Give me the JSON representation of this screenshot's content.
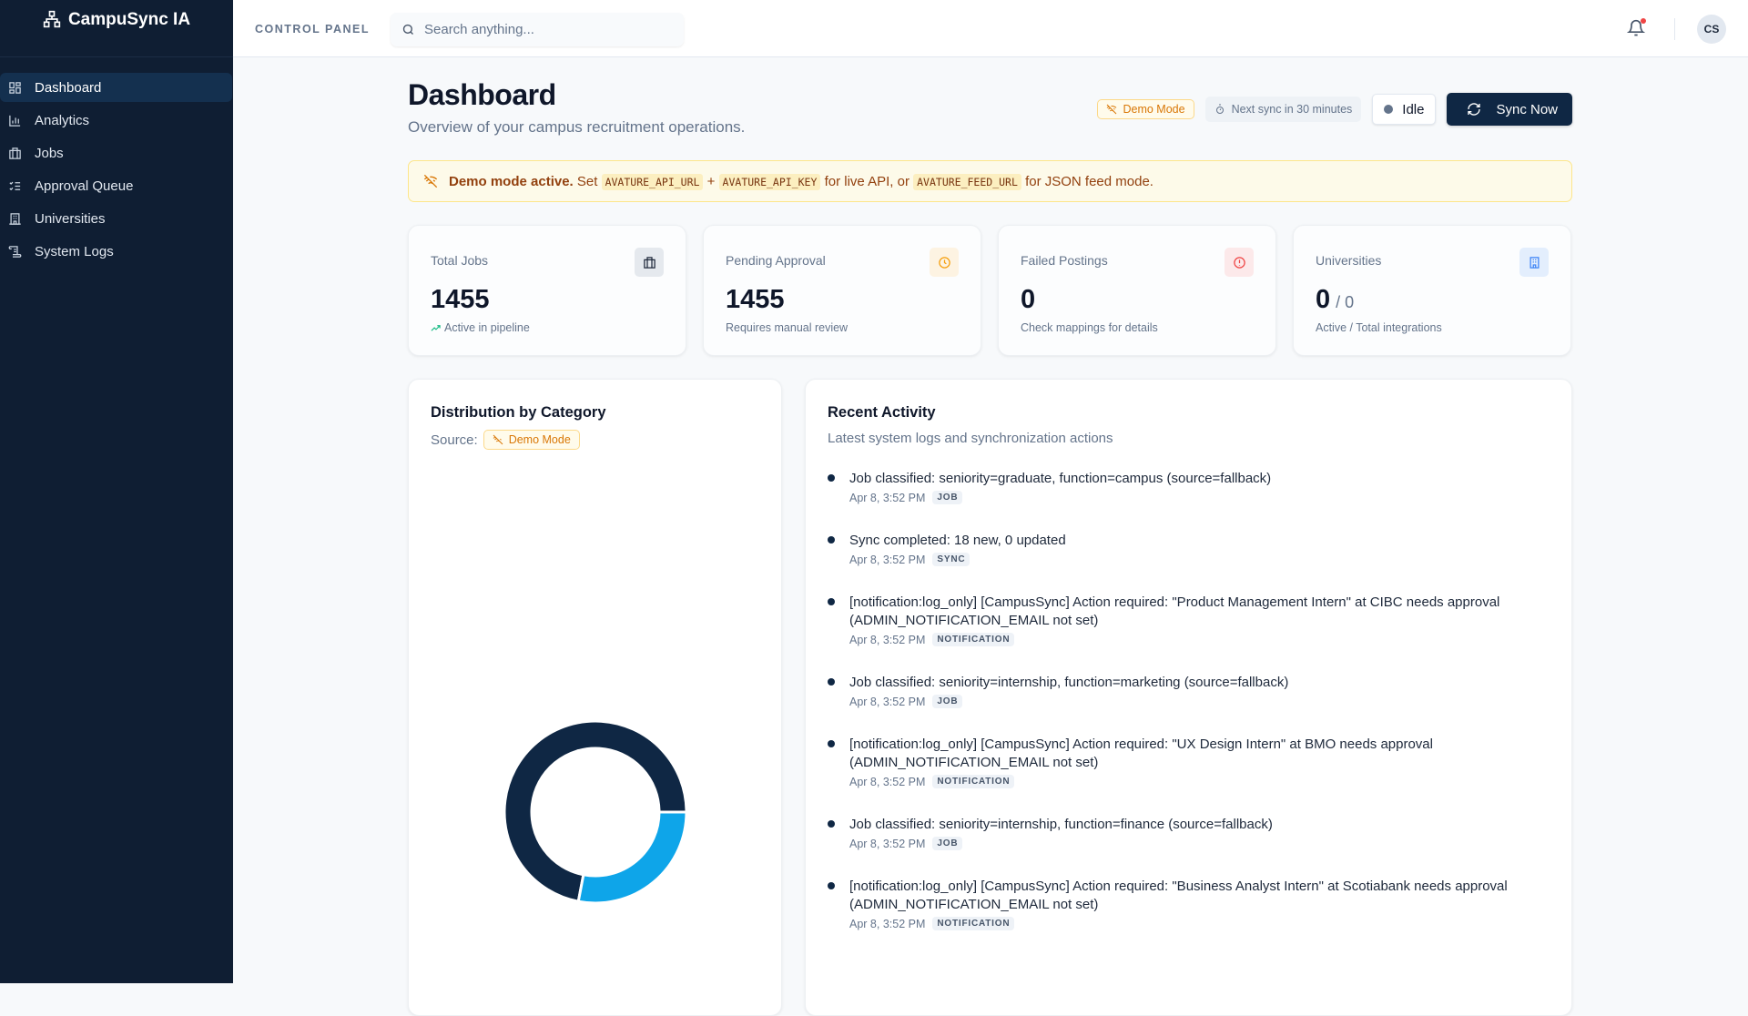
{
  "app": {
    "name": "CampuSync IA"
  },
  "sidebar": {
    "items": [
      {
        "label": "Dashboard",
        "icon": "dashboard-icon"
      },
      {
        "label": "Analytics",
        "icon": "bar-chart-icon"
      },
      {
        "label": "Jobs",
        "icon": "briefcase-icon"
      },
      {
        "label": "Approval Queue",
        "icon": "list-checks-icon"
      },
      {
        "label": "Universities",
        "icon": "building-icon"
      },
      {
        "label": "System Logs",
        "icon": "scroll-icon"
      }
    ]
  },
  "topbar": {
    "section": "CONTROL PANEL",
    "search_placeholder": "Search anything...",
    "avatar": "CS"
  },
  "header": {
    "title": "Dashboard",
    "subtitle": "Overview of your campus recruitment operations.",
    "demo_badge": "Demo Mode",
    "next_sync": "Next sync in 30 minutes",
    "status": "Idle",
    "sync_button": "Sync Now"
  },
  "banner": {
    "bold": "Demo mode active.",
    "t1": "Set",
    "code1": "AVATURE_API_URL",
    "t2": "+",
    "code2": "AVATURE_API_KEY",
    "t3": "for live API, or",
    "code3": "AVATURE_FEED_URL",
    "t4": "for JSON feed mode."
  },
  "stats": [
    {
      "label": "Total Jobs",
      "value": "1455",
      "sub": "Active in pipeline",
      "color": "#334155"
    },
    {
      "label": "Pending Approval",
      "value": "1455",
      "sub": "Requires manual review",
      "color": "#f59e0b"
    },
    {
      "label": "Failed Postings",
      "value": "0",
      "sub": "Check mappings for details",
      "color": "#ef4444"
    },
    {
      "label": "Universities",
      "value": "0",
      "total": "/ 0",
      "sub": "Active / Total integrations",
      "color": "#3b82f6"
    }
  ],
  "distribution": {
    "title": "Distribution by Category",
    "source_label": "Source:",
    "source_badge": "Demo Mode"
  },
  "chart_data": {
    "type": "pie",
    "donut": true,
    "title": "Distribution by Category",
    "series": [
      {
        "value": 72,
        "color": "#0f2744"
      },
      {
        "value": 28,
        "color": "#0ea5e9"
      }
    ]
  },
  "activity": {
    "title": "Recent Activity",
    "subtitle": "Latest system logs and synchronization actions",
    "items": [
      {
        "text": "Job classified: seniority=graduate, function=campus (source=fallback)",
        "time": "Apr 8, 3:52 PM",
        "tag": "JOB"
      },
      {
        "text": "Sync completed: 18 new, 0 updated",
        "time": "Apr 8, 3:52 PM",
        "tag": "SYNC"
      },
      {
        "text": "[notification:log_only] [CampusSync] Action required: \"Product Management Intern\" at CIBC needs approval (ADMIN_NOTIFICATION_EMAIL not set)",
        "time": "Apr 8, 3:52 PM",
        "tag": "NOTIFICATION"
      },
      {
        "text": "Job classified: seniority=internship, function=marketing (source=fallback)",
        "time": "Apr 8, 3:52 PM",
        "tag": "JOB"
      },
      {
        "text": "[notification:log_only] [CampusSync] Action required: \"UX Design Intern\" at BMO needs approval (ADMIN_NOTIFICATION_EMAIL not set)",
        "time": "Apr 8, 3:52 PM",
        "tag": "NOTIFICATION"
      },
      {
        "text": "Job classified: seniority=internship, function=finance (source=fallback)",
        "time": "Apr 8, 3:52 PM",
        "tag": "JOB"
      },
      {
        "text": "[notification:log_only] [CampusSync] Action required: \"Business Analyst Intern\" at Scotiabank needs approval (ADMIN_NOTIFICATION_EMAIL not set)",
        "time": "Apr 8, 3:52 PM",
        "tag": "NOTIFICATION"
      }
    ]
  }
}
